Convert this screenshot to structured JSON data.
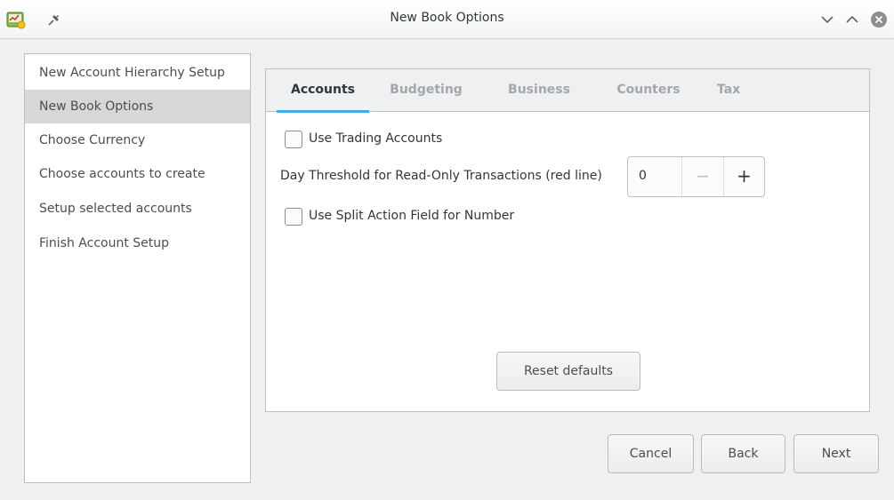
{
  "window": {
    "title": "New Book Options",
    "icons": {
      "app": "gnucash-app-icon",
      "pin": "pin-icon",
      "minimize": "chevron-down-icon",
      "maximize": "chevron-up-icon",
      "close": "close-icon"
    }
  },
  "sidebar": {
    "items": [
      {
        "label": "New Account Hierarchy Setup",
        "selected": false
      },
      {
        "label": "New Book Options",
        "selected": true
      },
      {
        "label": "Choose Currency",
        "selected": false
      },
      {
        "label": "Choose accounts to create",
        "selected": false
      },
      {
        "label": "Setup selected accounts",
        "selected": false
      },
      {
        "label": "Finish Account Setup",
        "selected": false
      }
    ]
  },
  "tabs": [
    {
      "label": "Accounts",
      "active": true
    },
    {
      "label": "Budgeting",
      "active": false
    },
    {
      "label": "Business",
      "active": false
    },
    {
      "label": "Counters",
      "active": false
    },
    {
      "label": "Tax",
      "active": false
    }
  ],
  "accounts_tab": {
    "use_trading_accounts": {
      "label": "Use Trading Accounts",
      "checked": false
    },
    "day_threshold": {
      "label": "Day Threshold for Read-Only Transactions (red line)",
      "value": "0",
      "minus": "−",
      "plus": "+"
    },
    "use_split_action": {
      "label": "Use Split Action Field for Number",
      "checked": false
    },
    "reset_label": "Reset defaults"
  },
  "footer": {
    "cancel_label": "Cancel",
    "back_label": "Back",
    "next_label": "Next"
  },
  "colors": {
    "accent": "#3daee9",
    "close_button": "#8c8f92"
  }
}
